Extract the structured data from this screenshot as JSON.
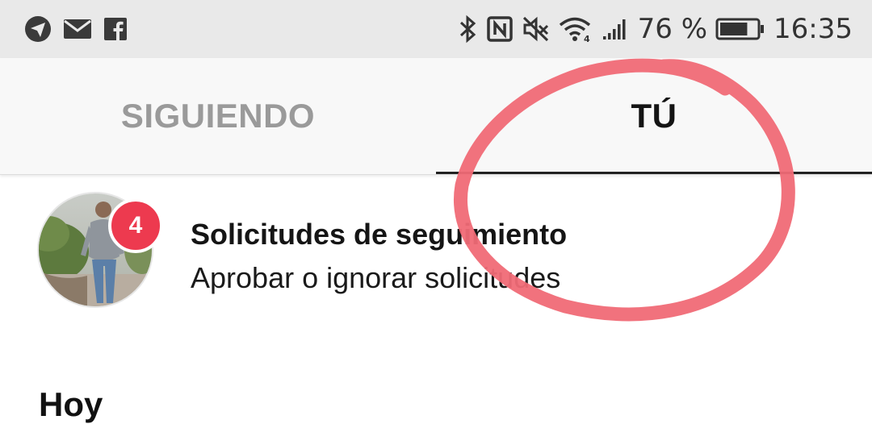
{
  "status_bar": {
    "battery_percent": "76 %",
    "time": "16:35",
    "left_icons": [
      "telegram-icon",
      "mail-icon",
      "facebook-icon"
    ],
    "right_icons": [
      "bluetooth-icon",
      "nfc-icon",
      "mute-icon",
      "wifi-icon",
      "signal-icon",
      "battery-icon"
    ],
    "battery_level": 0.76
  },
  "tabs": [
    {
      "label": "SIGUIENDO",
      "active": false
    },
    {
      "label": "TÚ",
      "active": true
    }
  ],
  "follow_requests": {
    "badge_count": "4",
    "title": "Solicitudes de seguimiento",
    "subtitle": "Aprobar o ignorar solicitudes"
  },
  "sections": {
    "today_label": "Hoy"
  },
  "colors": {
    "badge": "#ed3a4f",
    "annotation": "#f06a76",
    "status_bar_bg": "#e9e9e9",
    "tab_bg": "#f8f8f8",
    "inactive_tab_text": "#9a9a9a"
  }
}
